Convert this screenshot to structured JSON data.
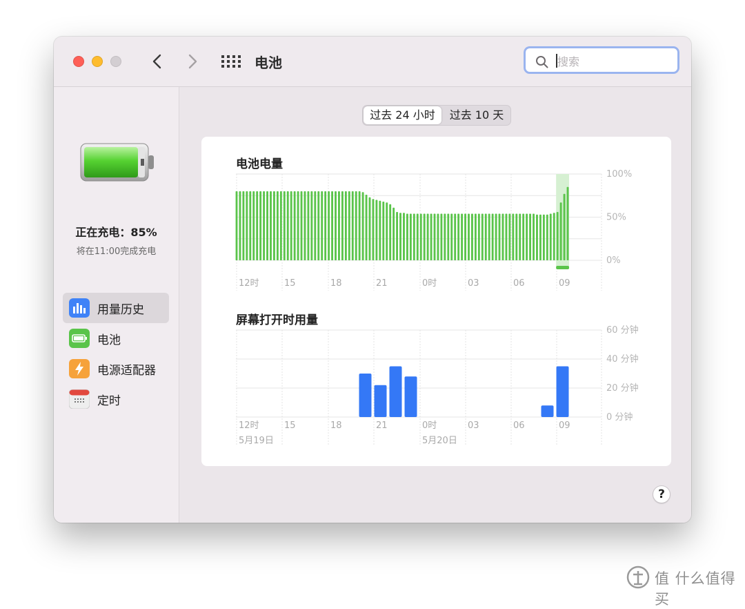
{
  "window": {
    "title": "电池"
  },
  "search": {
    "placeholder": "搜索"
  },
  "sidebar": {
    "status": "正在充电：85%",
    "substatus": "将在11:00完成充电",
    "items": [
      {
        "label": "用量历史",
        "icon": "bar-chart-icon",
        "selected": true
      },
      {
        "label": "电池",
        "icon": "battery-icon",
        "selected": false
      },
      {
        "label": "电源适配器",
        "icon": "lightning-icon",
        "selected": false
      },
      {
        "label": "定时",
        "icon": "calendar-icon",
        "selected": false
      }
    ]
  },
  "segments": {
    "options": [
      "过去 24 小时",
      "过去 10 天"
    ],
    "selected_index": 0
  },
  "colors": {
    "battery_green": "#5ac44a",
    "usage_blue": "#3478f6",
    "charging_highlight": "#d6f0d2"
  },
  "help_label": "?",
  "watermark": "值 什么值得买",
  "chart_data": [
    {
      "type": "bar",
      "title": "电池电量",
      "ylim": [
        0,
        100
      ],
      "y_ticks": [
        "100%",
        "50%",
        "0%"
      ],
      "x_ticks": [
        "12时",
        "15",
        "18",
        "21",
        "0时",
        "03",
        "06",
        "09"
      ],
      "series": [
        {
          "values": [
            80,
            80,
            80,
            80,
            80,
            80,
            80,
            80,
            80,
            80,
            80,
            80,
            80,
            80,
            80,
            80,
            80,
            80,
            80,
            80,
            80,
            80,
            80,
            80,
            80,
            80,
            80,
            80,
            80,
            80,
            80,
            80,
            80,
            80,
            80,
            80,
            80,
            79,
            76,
            73,
            71,
            70,
            69,
            68,
            67,
            65,
            61,
            56,
            55,
            55,
            54,
            54,
            54,
            54,
            54,
            54,
            54,
            54,
            54,
            54,
            54,
            54,
            54,
            54,
            54,
            54,
            54,
            54,
            54,
            54,
            54,
            54,
            54,
            54,
            54,
            54,
            54,
            54,
            54,
            54,
            54,
            54,
            54,
            54,
            54,
            54,
            54,
            54,
            53,
            53,
            53,
            53,
            54,
            55,
            56,
            67,
            77,
            85
          ]
        }
      ],
      "charging_marker_start_index": 94
    },
    {
      "type": "bar",
      "title": "屏幕打开时用量",
      "ylim": [
        0,
        60
      ],
      "y_ticks": [
        "60 分钟",
        "40 分钟",
        "20 分钟",
        "0 分钟"
      ],
      "x_ticks": [
        "12时",
        "15",
        "18",
        "21",
        "0时",
        "03",
        "06",
        "09"
      ],
      "date_labels": [
        {
          "label": "5月19日",
          "tick_index": 0
        },
        {
          "label": "5月20日",
          "tick_index": 4
        }
      ],
      "categories": [
        "12时",
        "13",
        "14",
        "15",
        "16",
        "17",
        "18",
        "19",
        "20",
        "21",
        "22",
        "23",
        "0时",
        "01",
        "02",
        "03",
        "04",
        "05",
        "06",
        "07",
        "08",
        "09"
      ],
      "series": [
        {
          "values": [
            0,
            0,
            0,
            0,
            0,
            0,
            0,
            0,
            30,
            22,
            35,
            28,
            0,
            0,
            0,
            0,
            0,
            0,
            0,
            0,
            8,
            35
          ]
        }
      ]
    }
  ]
}
